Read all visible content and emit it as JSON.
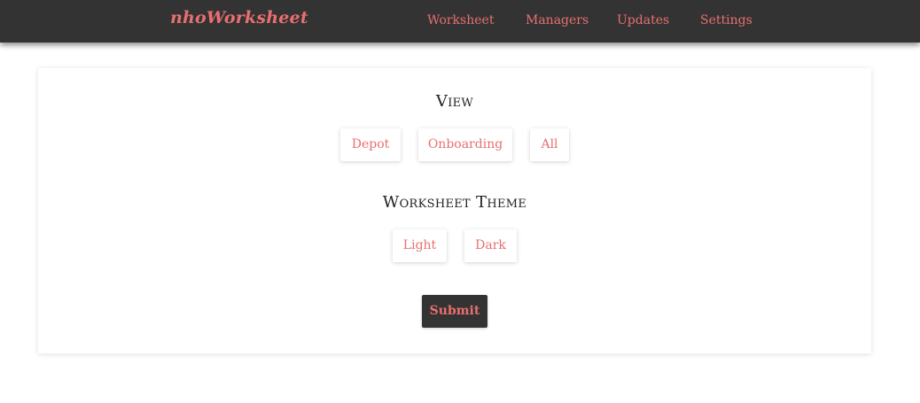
{
  "navbar": {
    "brand": "nhoWorksheet",
    "links": [
      "Worksheet",
      "Managers",
      "Updates",
      "Settings"
    ]
  },
  "settings": {
    "view": {
      "title": "View",
      "options": [
        "Depot",
        "Onboarding",
        "All"
      ]
    },
    "theme": {
      "title": "Worksheet Theme",
      "options": [
        "Light",
        "Dark"
      ]
    },
    "submit_label": "Submit"
  },
  "colors": {
    "accent": "#e96f6f",
    "navbar_bg": "#333333",
    "submit_bg": "#333333",
    "page_bg": "#ffffff",
    "heading_text": "#222222"
  }
}
